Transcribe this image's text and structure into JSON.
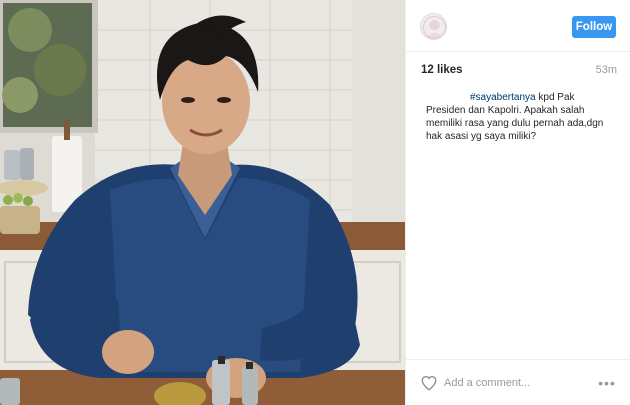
{
  "post": {
    "likes": "12 likes",
    "time": "53m",
    "caption_tag": "#sayabertanya",
    "caption_text": " kpd Pak Presiden dan Kapolri. Apakah salah memiliki rasa yang dulu pernah ada,dgn hak asasi yg saya miliki?"
  },
  "header": {
    "follow_label": "Follow"
  },
  "footer": {
    "comment_placeholder": "Add a comment...",
    "more_label": "•••"
  },
  "icons": {
    "heart": "heart-icon",
    "avatar": "avatar",
    "more": "more-options-icon"
  },
  "colors": {
    "follow_button": "#3897f0",
    "hashtag": "#003569",
    "muted": "#999999"
  }
}
